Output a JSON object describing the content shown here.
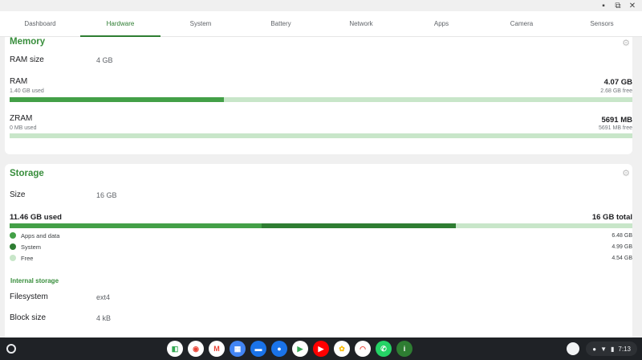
{
  "tabs": [
    {
      "label": "Dashboard"
    },
    {
      "label": "Hardware"
    },
    {
      "label": "System"
    },
    {
      "label": "Battery"
    },
    {
      "label": "Network"
    },
    {
      "label": "Apps"
    },
    {
      "label": "Camera"
    },
    {
      "label": "Sensors"
    }
  ],
  "active_tab": "Hardware",
  "memory": {
    "title": "Memory",
    "ram_size_label": "RAM size",
    "ram_size_value": "4 GB",
    "ram": {
      "name": "RAM",
      "used": "1.40 GB used",
      "total": "4.07 GB",
      "free": "2.68 GB free",
      "used_fraction": 0.344
    },
    "zram": {
      "name": "ZRAM",
      "used": "0 MB used",
      "total": "5691 MB",
      "free": "5691 MB free",
      "used_fraction": 0.0
    }
  },
  "storage": {
    "title": "Storage",
    "size_label": "Size",
    "size_value": "16 GB",
    "used_title": "11.46 GB used",
    "total_title": "16 GB total",
    "segments": [
      {
        "name": "Apps and data",
        "value": "6.48 GB",
        "color": "#43a047",
        "fraction": 0.405
      },
      {
        "name": "System",
        "value": "4.99 GB",
        "color": "#2e7d32",
        "fraction": 0.312
      },
      {
        "name": "Free",
        "value": "4.54 GB",
        "color": "#c8e6c9",
        "fraction": 0.283
      }
    ],
    "internal_title": "Internal storage",
    "filesystem_label": "Filesystem",
    "filesystem_value": "ext4",
    "block_label": "Block size",
    "block_value": "4 kB"
  },
  "shelf": {
    "apps": [
      {
        "name": "google-photos-edit-icon",
        "color": "#ffffff",
        "glyph": "◧",
        "fg": "#34a853"
      },
      {
        "name": "chrome-icon",
        "color": "#ffffff",
        "glyph": "◉",
        "fg": "#ea4335"
      },
      {
        "name": "gmail-icon",
        "color": "#ffffff",
        "glyph": "M",
        "fg": "#ea4335"
      },
      {
        "name": "calendar-icon",
        "color": "#4285f4",
        "glyph": "▦",
        "fg": "#ffffff"
      },
      {
        "name": "files-icon",
        "color": "#1a73e8",
        "glyph": "▬",
        "fg": "#ffffff"
      },
      {
        "name": "messages-icon",
        "color": "#1a73e8",
        "glyph": "●",
        "fg": "#ffffff"
      },
      {
        "name": "play-store-icon",
        "color": "#ffffff",
        "glyph": "▶",
        "fg": "#34a853"
      },
      {
        "name": "youtube-icon",
        "color": "#ff0000",
        "glyph": "▶",
        "fg": "#ffffff"
      },
      {
        "name": "photos-icon",
        "color": "#ffffff",
        "glyph": "✿",
        "fg": "#fbbc05"
      },
      {
        "name": "camera-app-icon",
        "color": "#ffffff",
        "glyph": "◠",
        "fg": "#ea4335"
      },
      {
        "name": "whatsapp-icon",
        "color": "#25d366",
        "glyph": "✆",
        "fg": "#ffffff"
      },
      {
        "name": "device-info-icon",
        "color": "#2e7d32",
        "glyph": "i",
        "fg": "#ffffff"
      }
    ],
    "time": "7:13"
  }
}
